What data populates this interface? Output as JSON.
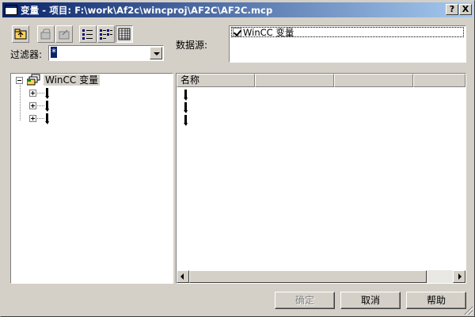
{
  "window": {
    "title": "变量 - 项目: F:\\work\\Af2c\\wincproj\\AF2C\\AF2C.mcp",
    "help_glyph": "?",
    "close_glyph": "X"
  },
  "toolbar": {
    "buttons": [
      {
        "icon": "folder-up-icon"
      },
      {
        "icon": "disabled-tool-icon-1"
      },
      {
        "icon": "disabled-tool-icon-2"
      },
      {
        "icon": "small-icons-view-icon"
      },
      {
        "icon": "list-view-icon"
      },
      {
        "icon": "details-view-icon"
      }
    ]
  },
  "filter": {
    "label": "过滤器:",
    "value": "*"
  },
  "data_source": {
    "label": "数据源:",
    "items": [
      {
        "label": "WinCC 变量",
        "checked": true
      }
    ]
  },
  "tree": {
    "root_label": "WinCC 变量",
    "children_count_visible": 3
  },
  "list": {
    "columns": [
      "名称",
      "",
      "",
      ""
    ],
    "rows_visible": 3
  },
  "buttons": {
    "ok": "确定",
    "cancel": "取消",
    "help": "帮助"
  },
  "colors": {
    "title_start": "#0a246a",
    "title_end": "#a6caf0",
    "face": "#d4d0c8"
  }
}
